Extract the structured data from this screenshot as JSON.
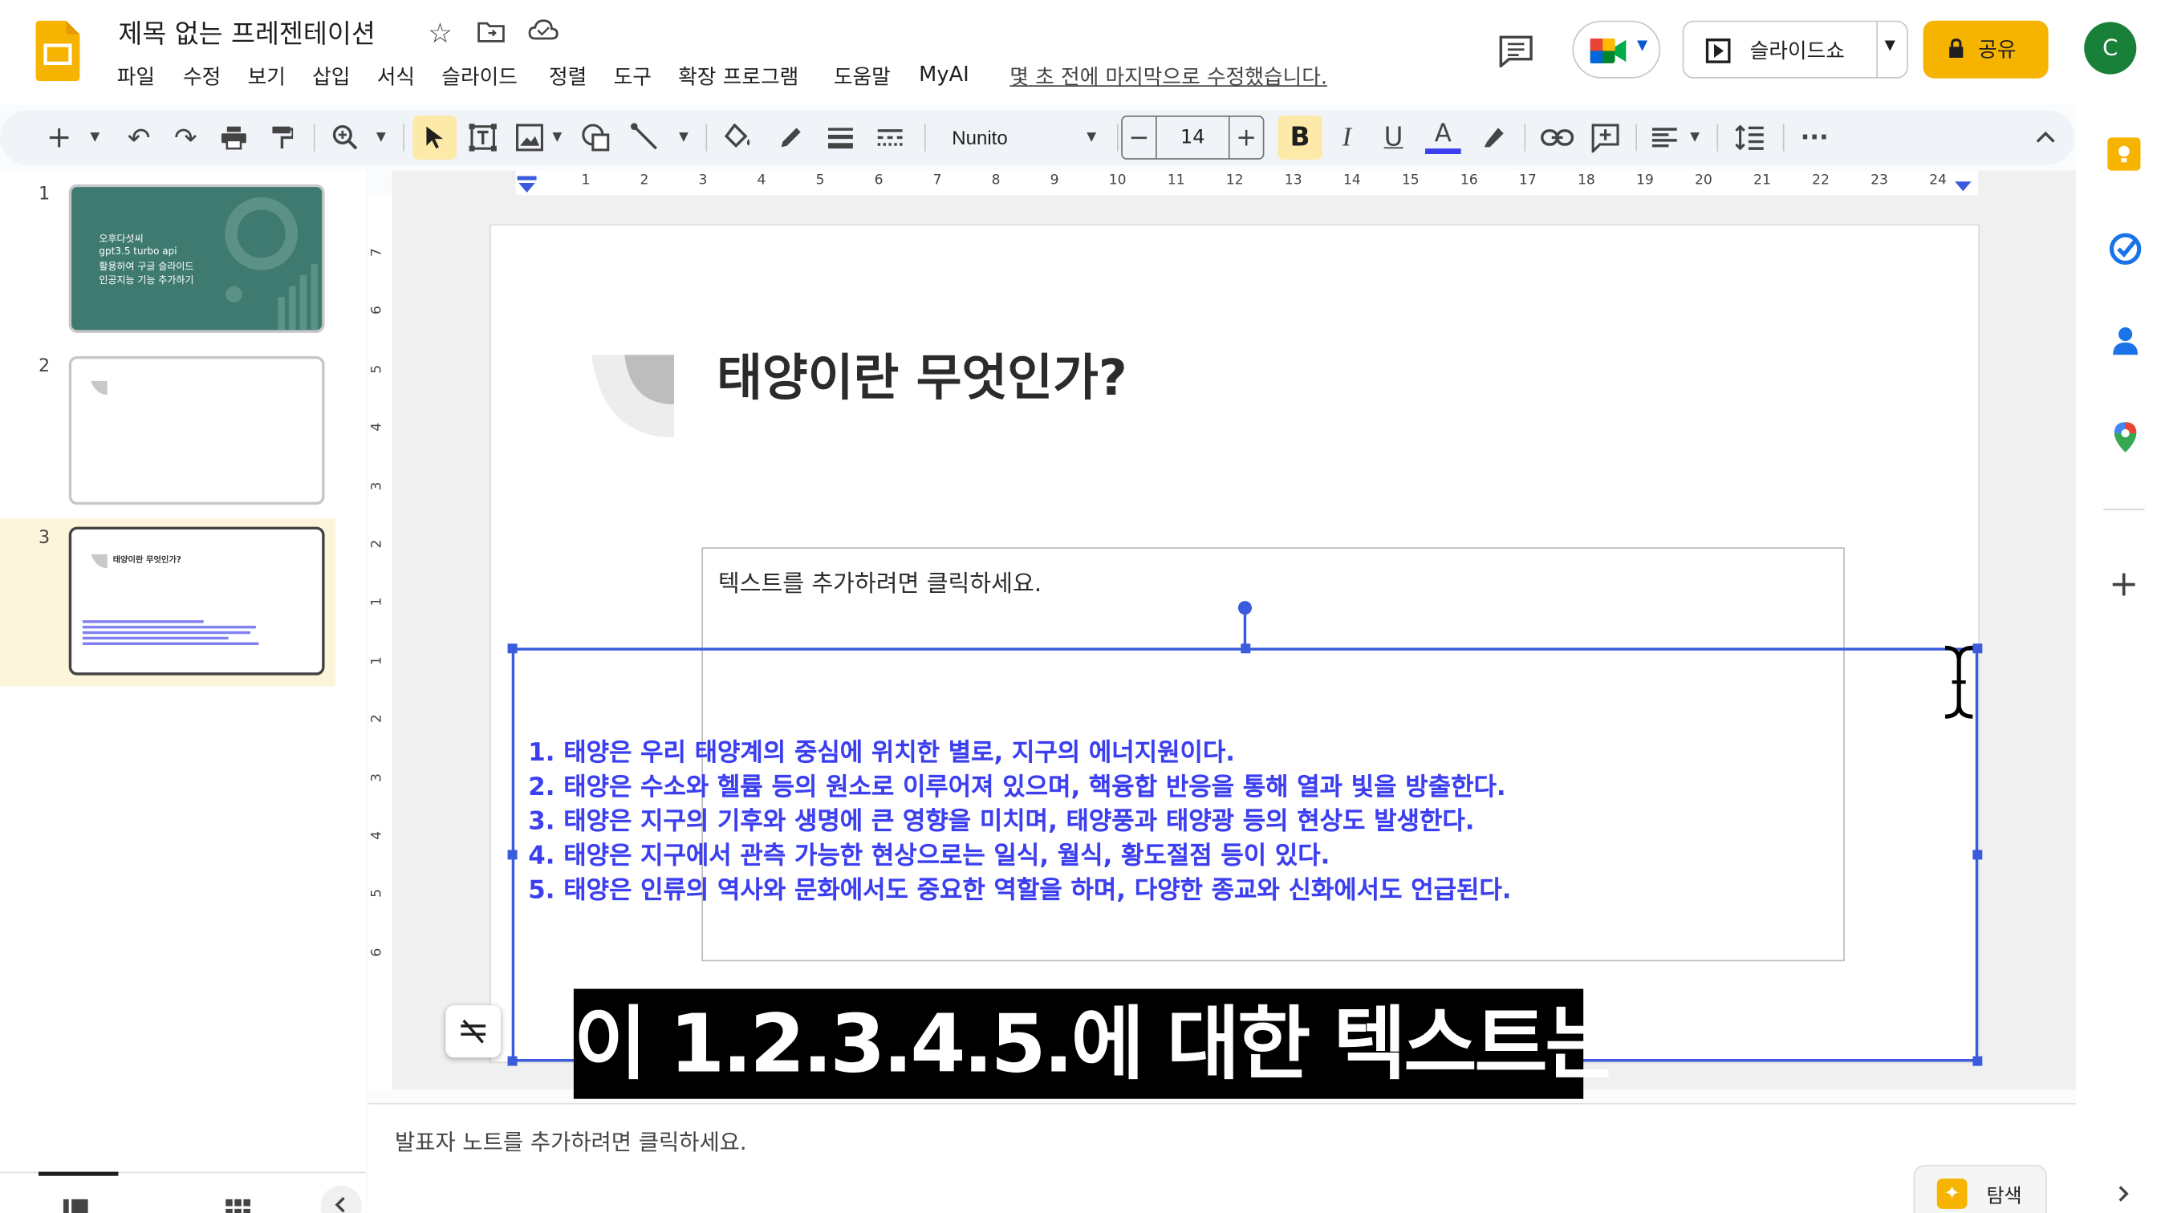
{
  "app": {
    "title": "제목 없는 프레젠테이션",
    "last_edit": "몇 초 전에 마지막으로 수정했습니다.",
    "menus": [
      "파일",
      "수정",
      "보기",
      "삽입",
      "서식",
      "슬라이드",
      "정렬",
      "도구",
      "확장 프로그램",
      "도움말",
      "MyAI"
    ],
    "slideshow_label": "슬라이드쇼",
    "share_label": "공유",
    "avatar_letter": "C"
  },
  "toolbar": {
    "font_name": "Nunito",
    "font_size": "14"
  },
  "slides": [
    {
      "number": "1",
      "lines": [
        "오후다섯씨",
        "gpt3.5 turbo api",
        "활용하여 구글 슬라이드",
        "인공지능 기능 추가하기"
      ]
    },
    {
      "number": "2"
    },
    {
      "number": "3",
      "title": "태양이란 무엇인가?"
    }
  ],
  "ruler": {
    "h_labels": [
      "1",
      "2",
      "3",
      "4",
      "5",
      "6",
      "7",
      "8",
      "9",
      "10",
      "11",
      "12",
      "13",
      "14",
      "15",
      "16",
      "17",
      "18",
      "19",
      "20",
      "21",
      "22",
      "23",
      "24"
    ],
    "v_labels": [
      "7",
      "6",
      "5",
      "4",
      "3",
      "2",
      "1",
      "1",
      "2",
      "3",
      "4",
      "5",
      "6"
    ]
  },
  "slide": {
    "title": "태양이란 무엇인가?",
    "placeholder": "텍스트를 추가하려면 클릭하세요.",
    "body": [
      "1. 태양은 우리 태양계의 중심에 위치한 별로, 지구의 에너지원이다.",
      "2. 태양은 수소와 헬륨 등의 원소로 이루어져 있으며, 핵융합 반응을 통해 열과 빛을 방출한다.",
      "3. 태양은 지구의 기후와 생명에 큰 영향을 미치며, 태양풍과 태양광 등의 현상도 발생한다.",
      "4. 태양은 지구에서 관측 가능한 현상으로는 일식, 월식, 황도절점 등이 있다.",
      "5. 태양은 인류의 역사와 문화에서도 중요한 역할을 하며, 다양한 종교와 신화에서도 언급된다."
    ]
  },
  "caption": "이 1.2.3.4.5.에 대한 텍스트는",
  "notes": {
    "placeholder": "발표자 노트를 추가하려면 클릭하세요."
  },
  "explore_label": "탐색",
  "colors": {
    "accent_yellow": "#f6b400",
    "body_text": "#3c3ff0",
    "selection": "#3a5bdc",
    "thumb1_bg": "#3f7a70"
  }
}
